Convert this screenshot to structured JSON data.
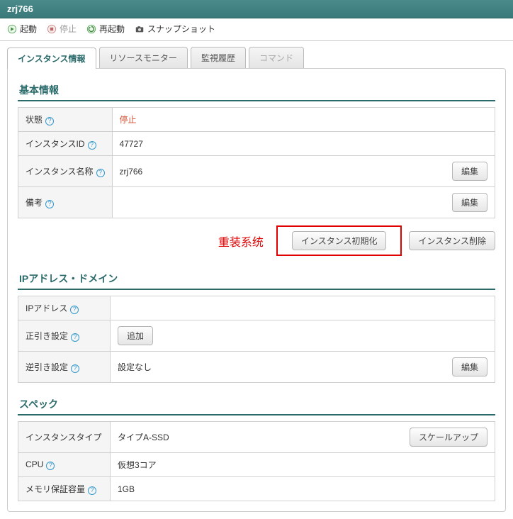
{
  "title": "zrj766",
  "toolbar": {
    "start": "起動",
    "stop": "停止",
    "restart": "再起動",
    "snapshot": "スナップショット"
  },
  "tabs": {
    "info": "インスタンス情報",
    "monitor": "リソースモニター",
    "history": "監視履歴",
    "command": "コマンド"
  },
  "sections": {
    "basic": "基本情報",
    "ip": "IPアドレス・ドメイン",
    "spec": "スペック"
  },
  "labels": {
    "status": "状態",
    "instance_id": "インスタンスID",
    "instance_name": "インスタンス名称",
    "note": "備考",
    "ip_address": "IPアドレス",
    "forward": "正引き設定",
    "reverse": "逆引き設定",
    "instance_type": "インスタンスタイプ",
    "cpu": "CPU",
    "memory": "メモリ保証容量"
  },
  "values": {
    "status": "停止",
    "instance_id": "47727",
    "instance_name": "zrj766",
    "note": "",
    "ip_address": "",
    "reverse": "設定なし",
    "instance_type": "タイプA-SSD",
    "cpu": "仮想3コア",
    "memory": "1GB"
  },
  "buttons": {
    "edit": "編集",
    "init": "インスタンス初期化",
    "delete": "インスタンス削除",
    "add": "追加",
    "scaleup": "スケールアップ"
  },
  "annotation": {
    "reinstall": "重装系统"
  }
}
